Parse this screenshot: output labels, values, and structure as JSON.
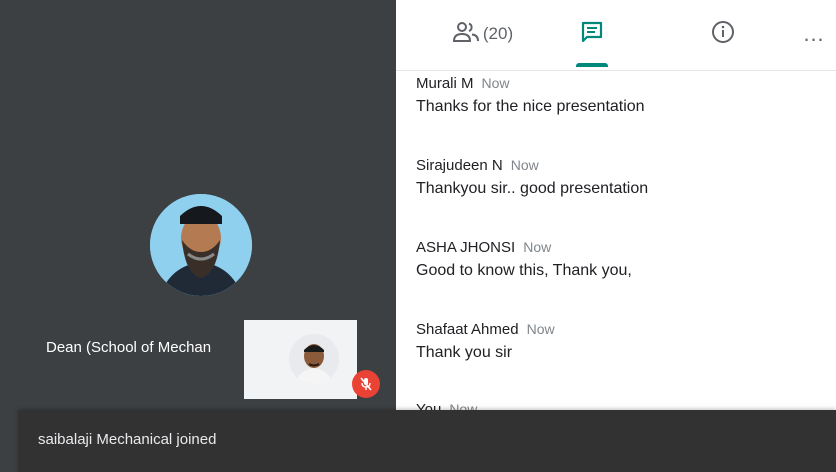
{
  "tabs": {
    "people_count": "(20)",
    "people_icon": "people-icon",
    "chat_icon": "chat-icon",
    "info_icon": "info-icon",
    "more_icon": "more-icon",
    "more_glyph": "…"
  },
  "main_participant": {
    "name": "Dean (School of Mechan"
  },
  "messages": [
    {
      "name": "Murali M",
      "time": "Now",
      "text": "Thanks for the nice presentation"
    },
    {
      "name": "Sirajudeen N",
      "time": "Now",
      "text": "Thankyou sir.. good presentation"
    },
    {
      "name": "ASHA JHONSI",
      "time": "Now",
      "text": "Good to know this, Thank you,"
    },
    {
      "name": "Shafaat Ahmed",
      "time": "Now",
      "text": "Thank you sir"
    },
    {
      "name": "You",
      "time": "Now",
      "text": ""
    }
  ],
  "toast": {
    "text": "saibalaji Mechanical joined"
  },
  "colors": {
    "accent": "#00897b",
    "mute": "#ea4335",
    "video_bg": "#3c4043"
  }
}
